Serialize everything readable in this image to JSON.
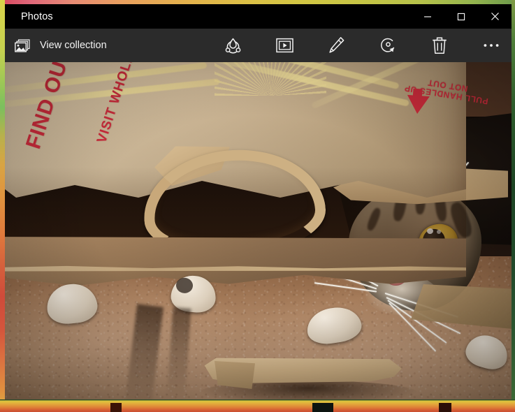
{
  "window": {
    "title": "Photos",
    "controls": [
      {
        "name": "minimize",
        "label": "─",
        "tooltip": "Minimize"
      },
      {
        "name": "maximize",
        "label": "☐",
        "tooltip": "Maximize"
      },
      {
        "name": "close",
        "label": "✕",
        "tooltip": "Close"
      }
    ],
    "frame_colors": {
      "top_gradient_start": "#d8485e",
      "top_gradient_end": "#6d9a4b",
      "left_border": "#d9d24a",
      "right_border": "#2f5c2c",
      "bottom_gradient_start": "#d8c73f",
      "bottom_gradient_end": "#c94e33"
    },
    "titlebar_bg": "#000000",
    "toolbar_bg": "#2b2b2b"
  },
  "toolbar": {
    "view_collection": {
      "label": "View collection",
      "icon": "photo-collection-icon"
    },
    "actions": [
      {
        "name": "share",
        "icon": "share-icon",
        "tooltip": "Share"
      },
      {
        "name": "slideshow",
        "icon": "slideshow-icon",
        "tooltip": "Slideshow"
      },
      {
        "name": "draw",
        "icon": "pencil-icon",
        "tooltip": "Draw"
      },
      {
        "name": "rotate",
        "icon": "rotate-icon",
        "tooltip": "Rotate"
      },
      {
        "name": "delete",
        "icon": "trash-icon",
        "tooltip": "Delete"
      },
      {
        "name": "see-more",
        "icon": "ellipsis-icon",
        "tooltip": "See more"
      }
    ]
  },
  "photo": {
    "description": "A brown tabby cat with white paws hiding inside a torn brown paper grocery bag on a carpeted floor",
    "printed_text": {
      "left_line_1": "FIND OUT WH",
      "left_line_2": "VISIT WHOLE",
      "right_line_1": "PULL HANDLES UP",
      "right_line_2": "NOT OUT"
    },
    "colors": {
      "bag_paper": "#d2b892",
      "bag_print_red": "#cf2c3c",
      "bag_print_yellow": "#f4e29c",
      "cat_eye": "#e8c65a",
      "cat_nose": "#d89a8e",
      "carpet": "#a37f5f"
    }
  }
}
